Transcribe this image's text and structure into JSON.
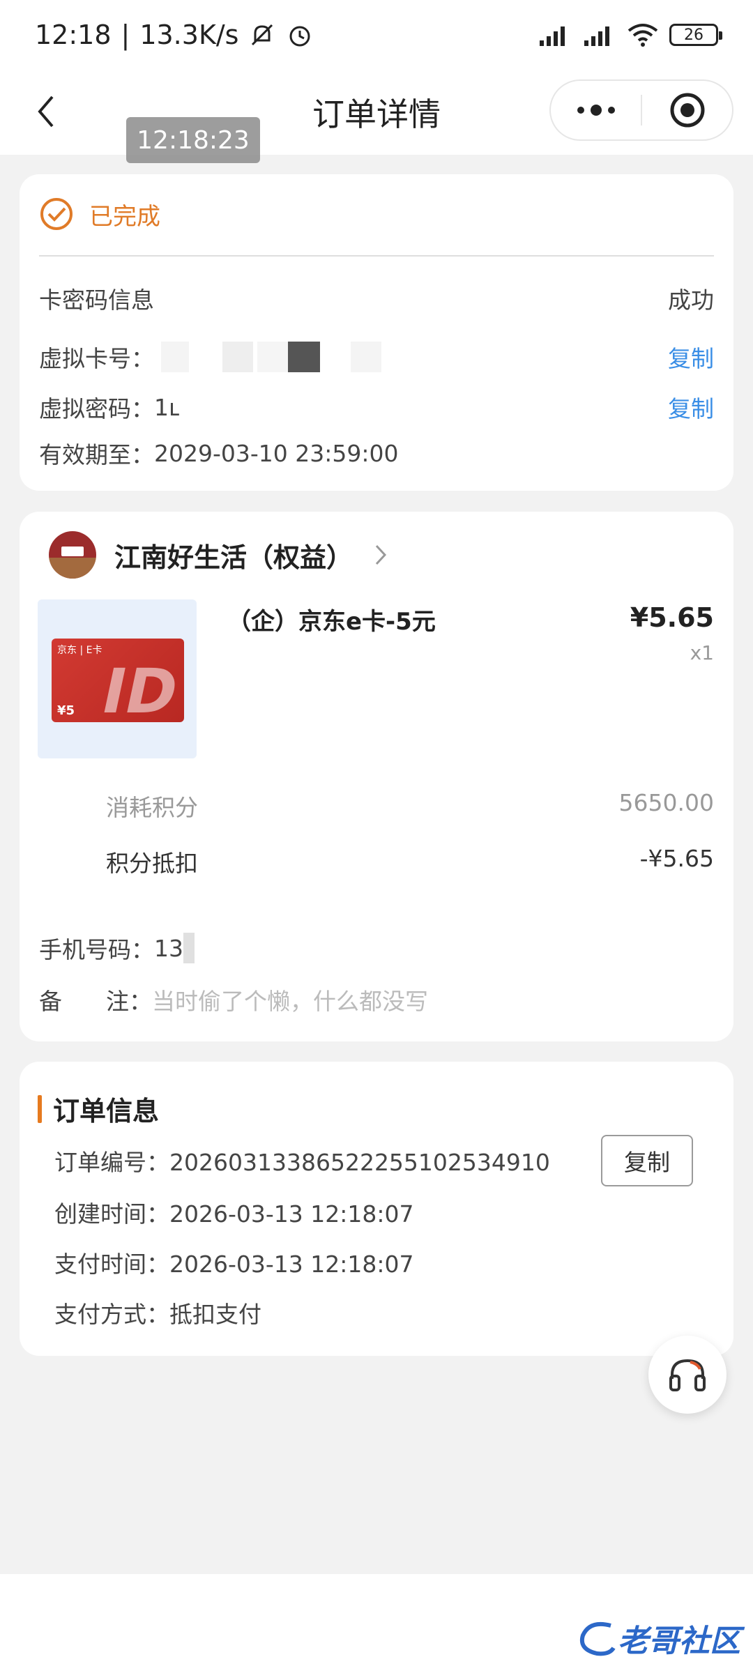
{
  "status_bar": {
    "time": "12:18",
    "speed": "13.3K/s",
    "battery": "26"
  },
  "nav": {
    "title": "订单详情"
  },
  "overlay_time": "12:18:23",
  "status_card": {
    "status": "已完成",
    "card_info_label": "卡密码信息",
    "card_info_value": "成功",
    "card_no_label": "虚拟卡号：",
    "password_label": "虚拟密码：",
    "password_value": "1ւ",
    "expire_label": "有效期至：",
    "expire_value": "2029-03-10 23:59:00",
    "copy": "复制"
  },
  "product_card": {
    "shop_name": "江南好生活（权益）",
    "product_name": "（企）京东e卡-5元",
    "price": "¥5.65",
    "qty": "x1",
    "card_brand": "京东 | E卡",
    "card_amount": "¥5",
    "points_used_label": "消耗积分",
    "points_used_value": "5650.00",
    "points_deduct_label": "积分抵扣",
    "points_deduct_value": "-¥5.65",
    "phone_label": "手机号码：",
    "phone_value": "13",
    "note_label": "备      注：",
    "note_value": "当时偷了个懒，什么都没写"
  },
  "order_info": {
    "title": "订单信息",
    "order_no_label": "订单编号：",
    "order_no": "20260313386522255102534910",
    "created_label": "创建时间：",
    "created": "2026-03-13 12:18:07",
    "paid_label": "支付时间：",
    "paid": "2026-03-13 12:18:07",
    "method_label": "支付方式：",
    "method": "抵扣支付",
    "copy": "复制"
  },
  "watermark": "老哥社区"
}
